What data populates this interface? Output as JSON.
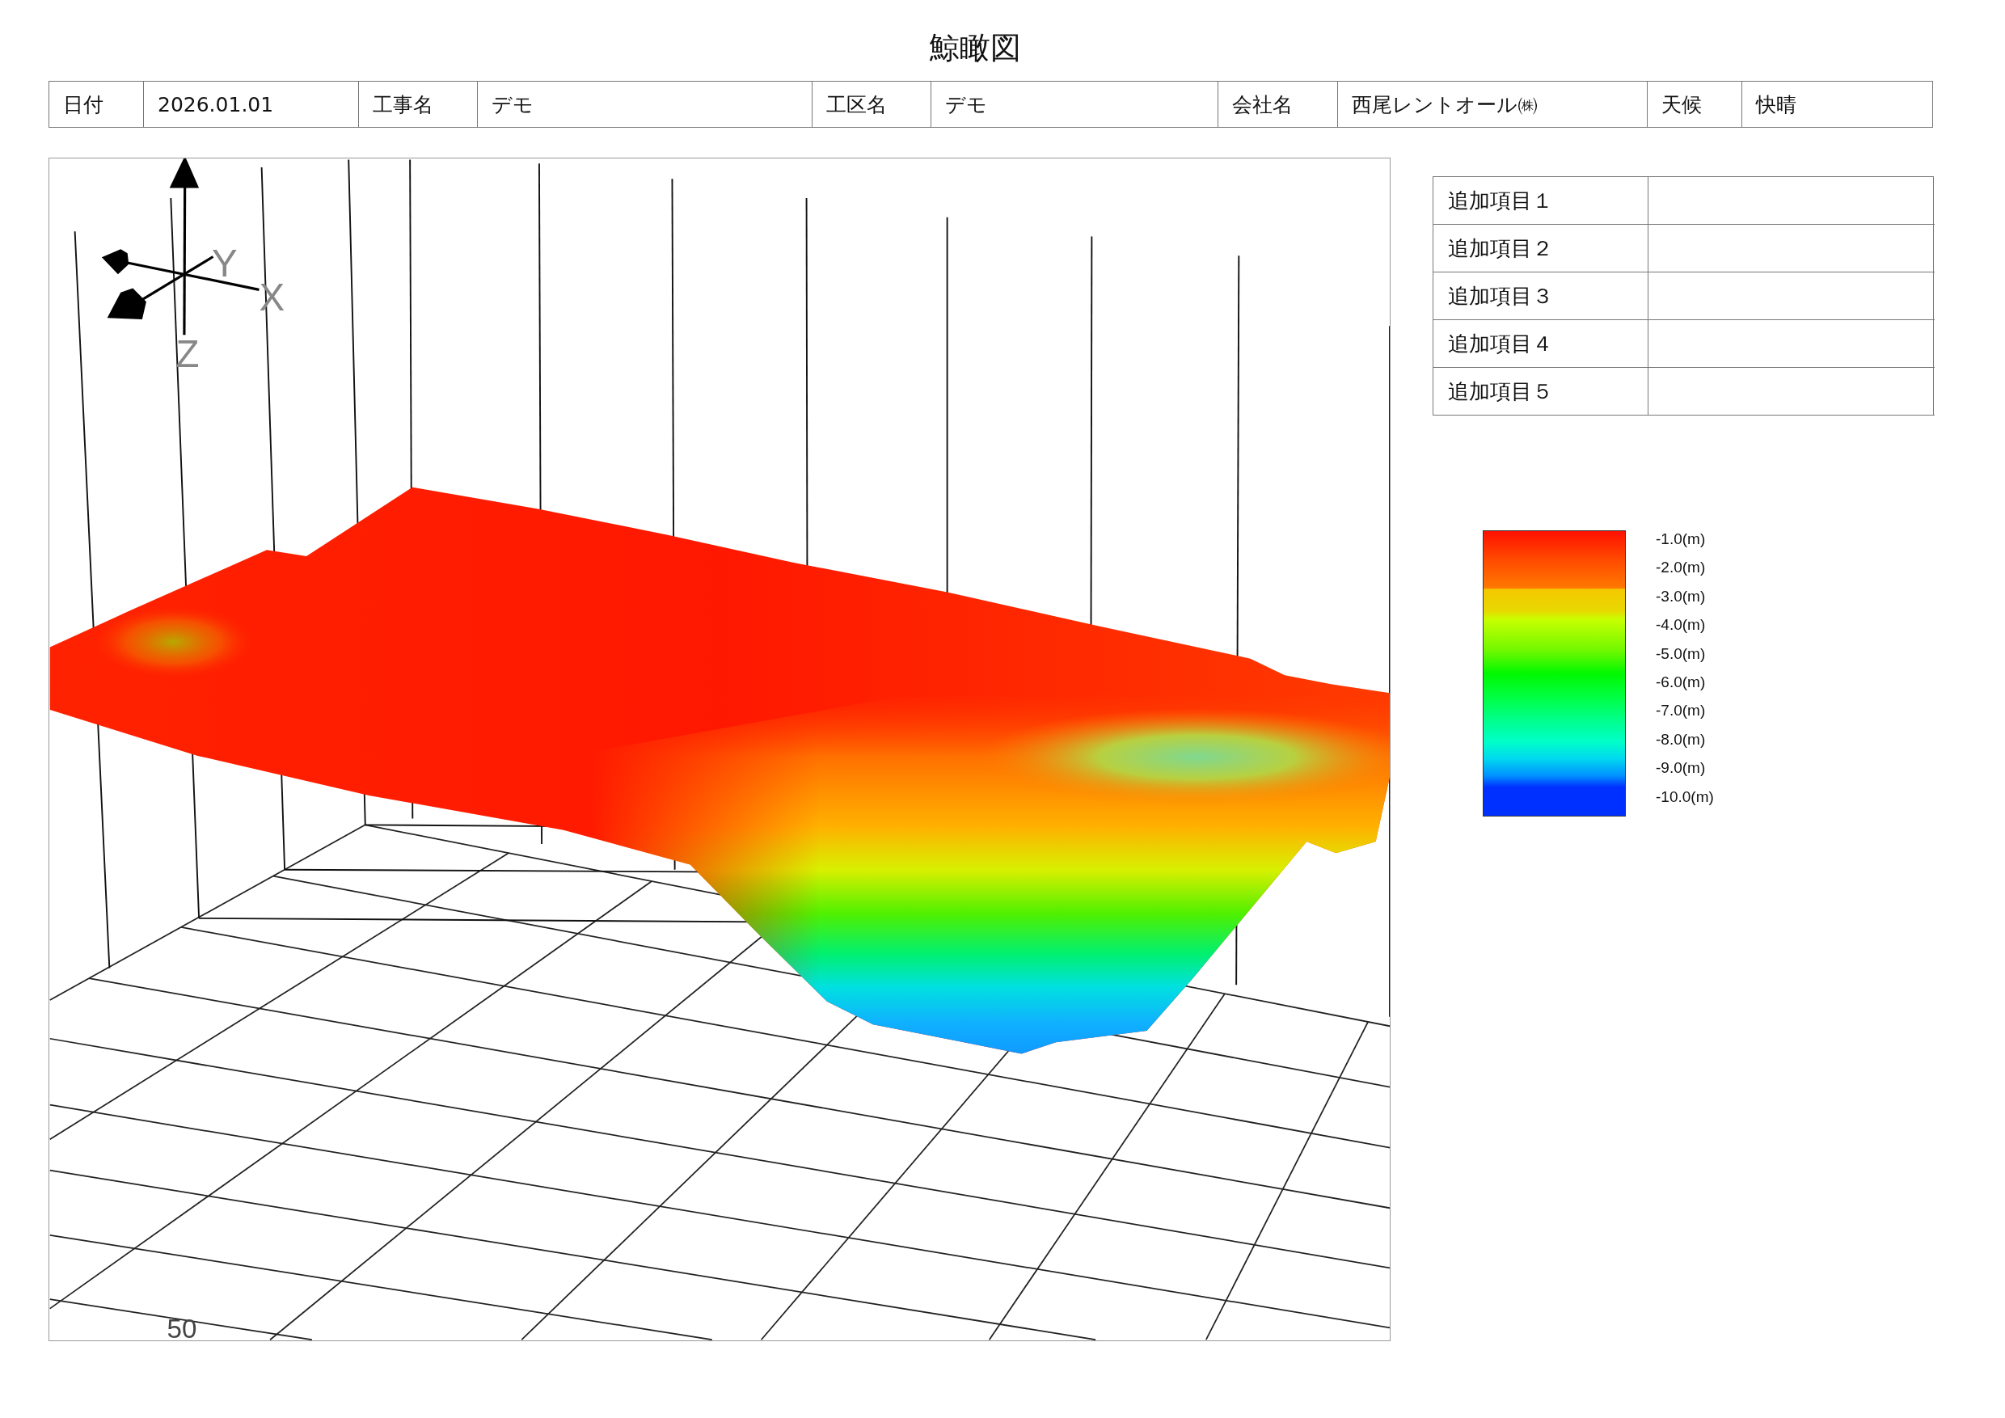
{
  "title": "鯨瞰図",
  "info_table": [
    {
      "label": "日付",
      "value": "2026.01.01"
    },
    {
      "label": "工事名",
      "value": "デモ"
    },
    {
      "label": "工区名",
      "value": "デモ"
    },
    {
      "label": "会社名",
      "value": "西尾レントオール㈱"
    },
    {
      "label": "天候",
      "value": "快晴"
    }
  ],
  "view": {
    "axes": {
      "y": "Y",
      "x": "X",
      "z": "Z"
    },
    "grid_label": "50"
  },
  "extra_items": [
    {
      "label": "追加項目１"
    },
    {
      "label": "追加項目２"
    },
    {
      "label": "追加項目３"
    },
    {
      "label": "追加項目４"
    },
    {
      "label": "追加項目５"
    }
  ],
  "legend": {
    "labels": [
      "-1.0(m)",
      "-2.0(m)",
      "-3.0(m)",
      "-4.0(m)",
      "-5.0(m)",
      "-6.0(m)",
      "-7.0(m)",
      "-8.0(m)",
      "-9.0(m)",
      "-10.0(m)"
    ]
  }
}
